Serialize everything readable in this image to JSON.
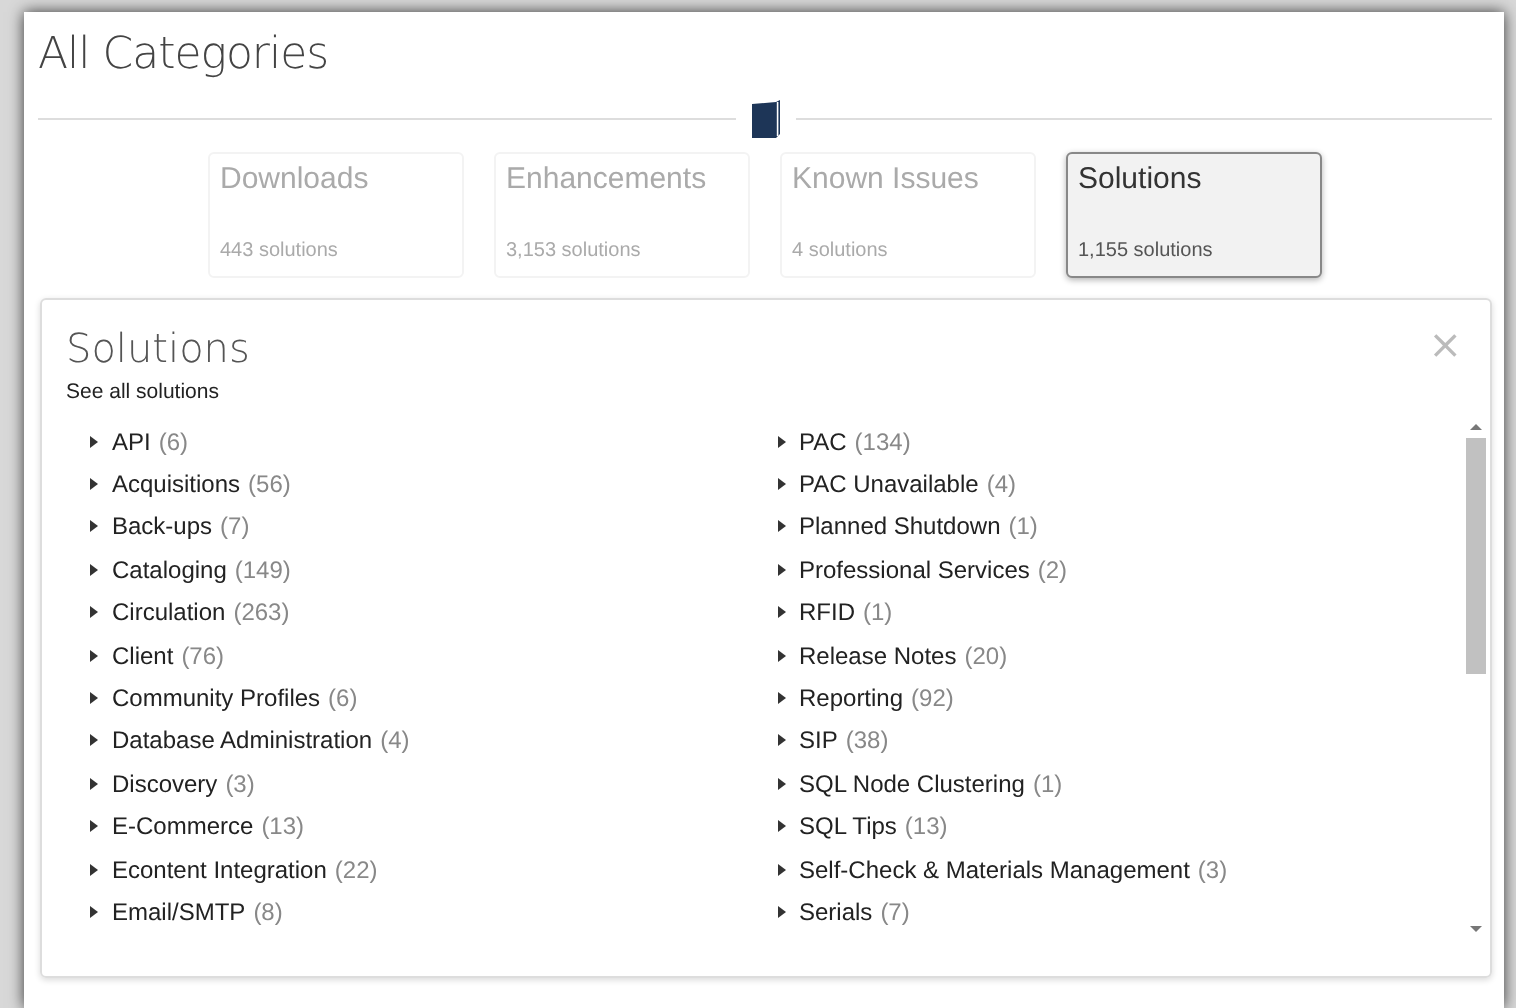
{
  "page": {
    "title": "All Categories"
  },
  "categories": [
    {
      "name": "Downloads",
      "count": "443 solutions",
      "selected": false
    },
    {
      "name": "Enhancements",
      "count": "3,153 solutions",
      "selected": false
    },
    {
      "name": "Known Issues",
      "count": "4 solutions",
      "selected": false
    },
    {
      "name": "Solutions",
      "count": "1,155 solutions",
      "selected": true
    }
  ],
  "panel": {
    "title": "Solutions",
    "link": "See all solutions",
    "close": "×",
    "columns": [
      [
        {
          "name": "API",
          "count": "(6)",
          "expanded": false
        },
        {
          "name": "Acquisitions",
          "count": "(56)",
          "expanded": false
        },
        {
          "name": "Back-ups",
          "count": "(7)",
          "expanded": false
        },
        {
          "name": "Cataloging",
          "count": "(149)",
          "expanded": false
        },
        {
          "name": "Circulation",
          "count": "(263)",
          "expanded": false
        },
        {
          "name": "Client",
          "count": "(76)",
          "expanded": false
        },
        {
          "name": "Community Profiles",
          "count": "(6)",
          "expanded": false
        },
        {
          "name": "Database Administration",
          "count": "(4)",
          "expanded": false
        },
        {
          "name": "Discovery",
          "count": "(3)",
          "expanded": false
        },
        {
          "name": "E-Commerce",
          "count": "(13)",
          "expanded": false
        },
        {
          "name": "Econtent Integration",
          "count": "(22)",
          "expanded": false
        },
        {
          "name": "Email/SMTP",
          "count": "(8)",
          "expanded": false
        }
      ],
      [
        {
          "name": "PAC",
          "count": "(134)",
          "expanded": false
        },
        {
          "name": "PAC Unavailable",
          "count": "(4)",
          "expanded": false
        },
        {
          "name": "Planned Shutdown",
          "count": "(1)",
          "expanded": false
        },
        {
          "name": "Professional Services",
          "count": "(2)",
          "expanded": false
        },
        {
          "name": "RFID",
          "count": "(1)",
          "expanded": false
        },
        {
          "name": "Release Notes",
          "count": "(20)",
          "expanded": false
        },
        {
          "name": "Reporting",
          "count": "(92)",
          "expanded": false
        },
        {
          "name": "SIP",
          "count": "(38)",
          "expanded": false
        },
        {
          "name": "SQL Node Clustering",
          "count": "(1)",
          "expanded": false
        },
        {
          "name": "SQL Tips",
          "count": "(13)",
          "expanded": false
        },
        {
          "name": "Self-Check & Materials Management",
          "count": "(3)",
          "expanded": false
        },
        {
          "name": "Serials",
          "count": "(7)",
          "expanded": false
        }
      ]
    ]
  }
}
